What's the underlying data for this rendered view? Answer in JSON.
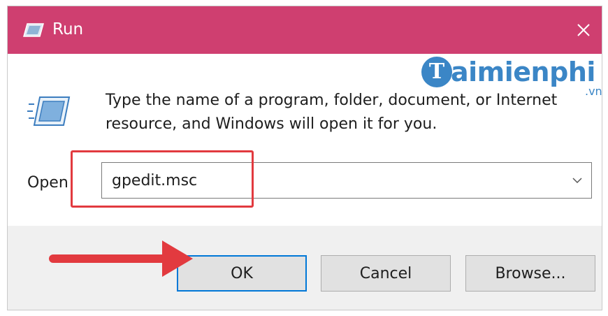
{
  "window": {
    "title": "Run",
    "accent_color": "#cf3f70"
  },
  "watermark": {
    "logo_letter": "T",
    "text": "aimienphi",
    "suffix": ".vn",
    "color": "#3b86c6"
  },
  "dialog": {
    "description": "Type the name of a program, folder, document, or Internet resource, and Windows will open it for you.",
    "open_label": "Open",
    "input_value": "gpedit.msc"
  },
  "buttons": {
    "ok_label": "OK",
    "cancel_label": "Cancel",
    "browse_label": "Browse..."
  },
  "annotations": {
    "highlight_color": "#e23a3f",
    "arrow_color": "#e23a3f"
  },
  "icons": {
    "title": "run-icon",
    "main": "run-icon",
    "close": "close-icon",
    "dropdown": "chevron-down-icon"
  }
}
